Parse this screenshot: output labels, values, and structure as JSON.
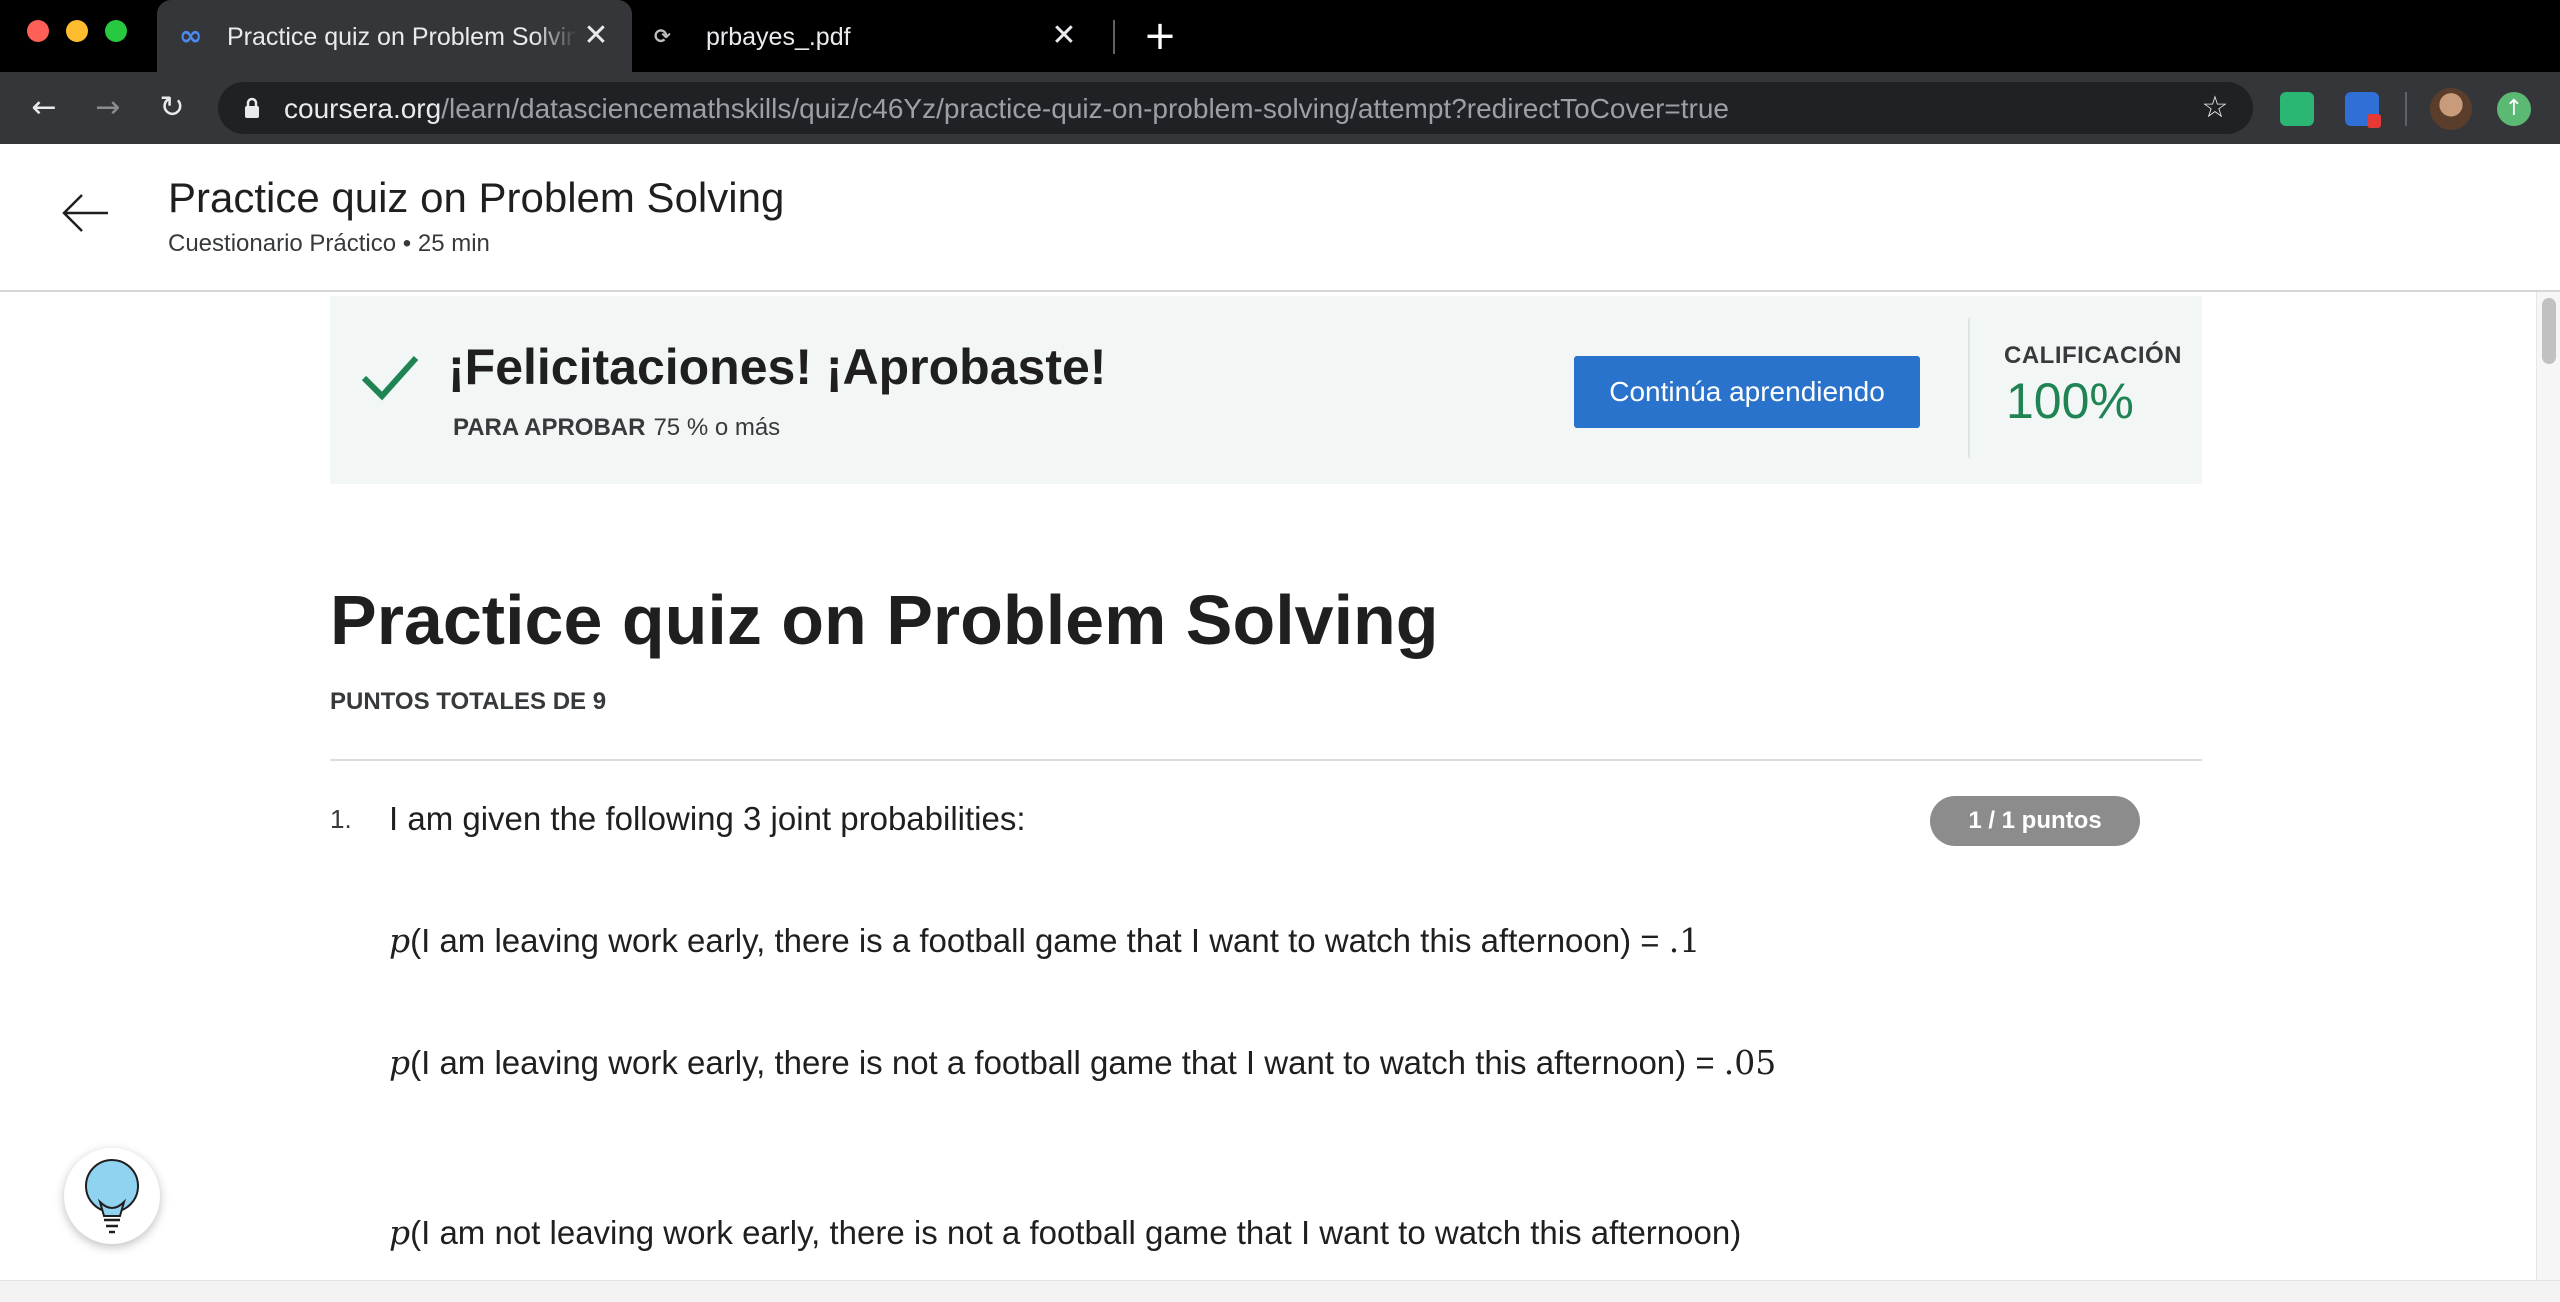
{
  "browser": {
    "tabs": [
      {
        "title": "Practice quiz on Problem Solving",
        "active": true,
        "icon": "coursera-icon"
      },
      {
        "title": "prbayes_.pdf",
        "active": false,
        "icon": "loading-icon"
      }
    ],
    "url_host": "coursera.org",
    "url_path": "/learn/datasciencemathskills/quiz/c46Yz/practice-quiz-on-problem-solving/attempt?redirectToCover=true"
  },
  "header": {
    "title": "Practice quiz on Problem Solving",
    "subtitle": "Cuestionario Práctico • 25 min"
  },
  "result_banner": {
    "message": "¡Felicitaciones! ¡Aprobaste!",
    "pass_label": "PARA APROBAR",
    "pass_value": "75 % o más",
    "continue_button": "Continúa aprendiendo",
    "grade_label": "CALIFICACIÓN",
    "grade_value": "100%",
    "accent_color": "#1f8354"
  },
  "quiz": {
    "title": "Practice quiz on Problem Solving",
    "total_points": "PUNTOS TOTALES DE 9",
    "questions": [
      {
        "number": "1.",
        "text": "I am given the following 3 joint probabilities:",
        "points": "1 / 1 puntos",
        "items": [
          {
            "p": "p",
            "body": "(I am leaving work early, there is a football game that I want to watch this afternoon) = ",
            "value": ".1"
          },
          {
            "p": "p",
            "body": "(I am leaving work early, there is not a football game that I want to watch this afternoon) = ",
            "value": ".05"
          },
          {
            "p": "p",
            "body": "(I am not leaving work early, there is not a football game that I want to watch this afternoon)",
            "value": ""
          }
        ]
      }
    ]
  },
  "colors": {
    "primary_button": "#2a73cc",
    "banner_background": "#f2f7f5"
  }
}
